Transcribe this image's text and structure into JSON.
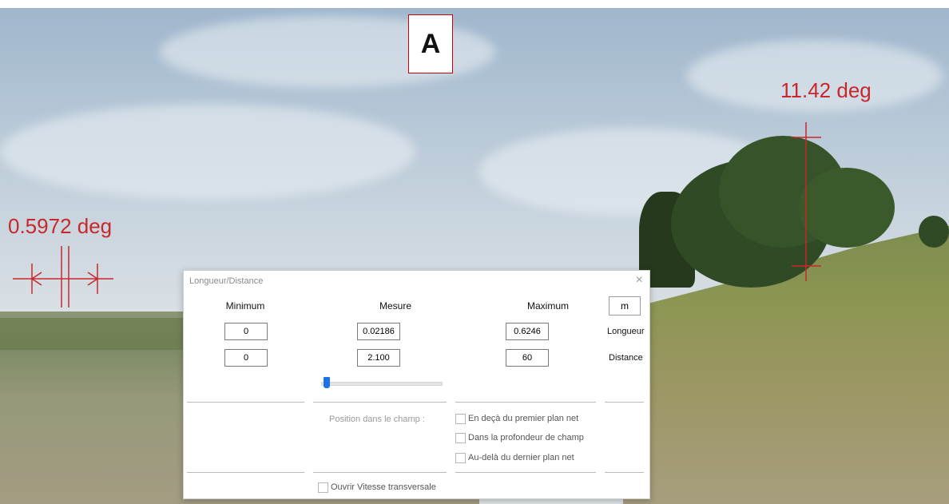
{
  "overlay": {
    "marker_label": "A",
    "left_angle": "0.5972 deg",
    "right_angle": "11.42 deg",
    "color": "#c8282b"
  },
  "dialog": {
    "title": "Longueur/Distance",
    "close_glyph": "×",
    "columns": {
      "min": "Minimum",
      "measure": "Mesure",
      "max": "Maximum"
    },
    "unit_button": "m",
    "rows": {
      "length": {
        "label": "Longueur",
        "min": "0",
        "measure": "0.02186",
        "max": "0.6246"
      },
      "distance": {
        "label": "Distance",
        "min": "0",
        "measure": "2.100",
        "max": "60"
      }
    },
    "slider": {
      "value_fraction": 0.02,
      "accent": "#1a73e8"
    },
    "position_label": "Position dans le champ :",
    "checkboxes": {
      "before_focus": "En deçà du premier plan net",
      "depth_of_field": "Dans la profondeur de champ",
      "beyond_focus": "Au-delà du dernier plan net",
      "transverse_speed": "Ouvrir Vitesse transversale"
    }
  }
}
